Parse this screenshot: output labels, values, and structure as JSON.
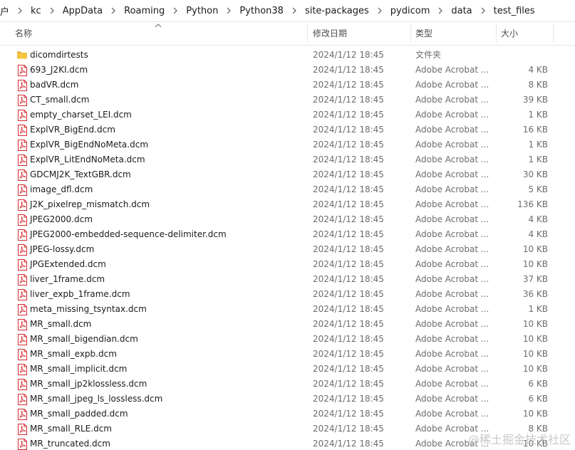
{
  "breadcrumb": {
    "items": [
      "户",
      "kc",
      "AppData",
      "Roaming",
      "Python",
      "Python38",
      "site-packages",
      "pydicom",
      "data",
      "test_files"
    ]
  },
  "columns": {
    "name": "名称",
    "date": "修改日期",
    "type": "类型",
    "size": "大小"
  },
  "files": [
    {
      "name": "dicomdirtests",
      "date": "2024/1/12 18:45",
      "type": "文件夹",
      "size": "",
      "icon": "folder-icon"
    },
    {
      "name": "693_J2KI.dcm",
      "date": "2024/1/12 18:45",
      "type": "Adobe Acrobat ...",
      "size": "4 KB",
      "icon": "pdf-file-icon"
    },
    {
      "name": "badVR.dcm",
      "date": "2024/1/12 18:45",
      "type": "Adobe Acrobat ...",
      "size": "8 KB",
      "icon": "pdf-file-icon"
    },
    {
      "name": "CT_small.dcm",
      "date": "2024/1/12 18:45",
      "type": "Adobe Acrobat ...",
      "size": "39 KB",
      "icon": "pdf-file-icon"
    },
    {
      "name": "empty_charset_LEI.dcm",
      "date": "2024/1/12 18:45",
      "type": "Adobe Acrobat ...",
      "size": "1 KB",
      "icon": "pdf-file-icon"
    },
    {
      "name": "ExplVR_BigEnd.dcm",
      "date": "2024/1/12 18:45",
      "type": "Adobe Acrobat ...",
      "size": "16 KB",
      "icon": "pdf-file-icon"
    },
    {
      "name": "ExplVR_BigEndNoMeta.dcm",
      "date": "2024/1/12 18:45",
      "type": "Adobe Acrobat ...",
      "size": "1 KB",
      "icon": "pdf-file-icon"
    },
    {
      "name": "ExplVR_LitEndNoMeta.dcm",
      "date": "2024/1/12 18:45",
      "type": "Adobe Acrobat ...",
      "size": "1 KB",
      "icon": "pdf-file-icon"
    },
    {
      "name": "GDCMJ2K_TextGBR.dcm",
      "date": "2024/1/12 18:45",
      "type": "Adobe Acrobat ...",
      "size": "30 KB",
      "icon": "pdf-file-icon"
    },
    {
      "name": "image_dfl.dcm",
      "date": "2024/1/12 18:45",
      "type": "Adobe Acrobat ...",
      "size": "5 KB",
      "icon": "pdf-file-icon"
    },
    {
      "name": "J2K_pixelrep_mismatch.dcm",
      "date": "2024/1/12 18:45",
      "type": "Adobe Acrobat ...",
      "size": "136 KB",
      "icon": "pdf-file-icon"
    },
    {
      "name": "JPEG2000.dcm",
      "date": "2024/1/12 18:45",
      "type": "Adobe Acrobat ...",
      "size": "4 KB",
      "icon": "pdf-file-icon"
    },
    {
      "name": "JPEG2000-embedded-sequence-delimiter.dcm",
      "date": "2024/1/12 18:45",
      "type": "Adobe Acrobat ...",
      "size": "4 KB",
      "icon": "pdf-file-icon"
    },
    {
      "name": "JPEG-lossy.dcm",
      "date": "2024/1/12 18:45",
      "type": "Adobe Acrobat ...",
      "size": "10 KB",
      "icon": "pdf-file-icon"
    },
    {
      "name": "JPGExtended.dcm",
      "date": "2024/1/12 18:45",
      "type": "Adobe Acrobat ...",
      "size": "10 KB",
      "icon": "pdf-file-icon"
    },
    {
      "name": "liver_1frame.dcm",
      "date": "2024/1/12 18:45",
      "type": "Adobe Acrobat ...",
      "size": "37 KB",
      "icon": "pdf-file-icon"
    },
    {
      "name": "liver_expb_1frame.dcm",
      "date": "2024/1/12 18:45",
      "type": "Adobe Acrobat ...",
      "size": "36 KB",
      "icon": "pdf-file-icon"
    },
    {
      "name": "meta_missing_tsyntax.dcm",
      "date": "2024/1/12 18:45",
      "type": "Adobe Acrobat ...",
      "size": "1 KB",
      "icon": "pdf-file-icon"
    },
    {
      "name": "MR_small.dcm",
      "date": "2024/1/12 18:45",
      "type": "Adobe Acrobat ...",
      "size": "10 KB",
      "icon": "pdf-file-icon"
    },
    {
      "name": "MR_small_bigendian.dcm",
      "date": "2024/1/12 18:45",
      "type": "Adobe Acrobat ...",
      "size": "10 KB",
      "icon": "pdf-file-icon"
    },
    {
      "name": "MR_small_expb.dcm",
      "date": "2024/1/12 18:45",
      "type": "Adobe Acrobat ...",
      "size": "10 KB",
      "icon": "pdf-file-icon"
    },
    {
      "name": "MR_small_implicit.dcm",
      "date": "2024/1/12 18:45",
      "type": "Adobe Acrobat ...",
      "size": "10 KB",
      "icon": "pdf-file-icon"
    },
    {
      "name": "MR_small_jp2klossless.dcm",
      "date": "2024/1/12 18:45",
      "type": "Adobe Acrobat ...",
      "size": "6 KB",
      "icon": "pdf-file-icon"
    },
    {
      "name": "MR_small_jpeg_ls_lossless.dcm",
      "date": "2024/1/12 18:45",
      "type": "Adobe Acrobat ...",
      "size": "6 KB",
      "icon": "pdf-file-icon"
    },
    {
      "name": "MR_small_padded.dcm",
      "date": "2024/1/12 18:45",
      "type": "Adobe Acrobat ...",
      "size": "10 KB",
      "icon": "pdf-file-icon"
    },
    {
      "name": "MR_small_RLE.dcm",
      "date": "2024/1/12 18:45",
      "type": "Adobe Acrobat ...",
      "size": "8 KB",
      "icon": "pdf-file-icon"
    },
    {
      "name": "MR_truncated.dcm",
      "date": "2024/1/12 18:45",
      "type": "Adobe Acrobat ...",
      "size": "10 KB",
      "icon": "pdf-file-icon"
    }
  ],
  "watermark": "@稀土掘金技术社区",
  "colors": {
    "pdf_icon_red": "#d7282f",
    "folder_yellow": "#f5c542",
    "folder_dark": "#e0a82e",
    "muted_text": "#6d6d6d"
  }
}
